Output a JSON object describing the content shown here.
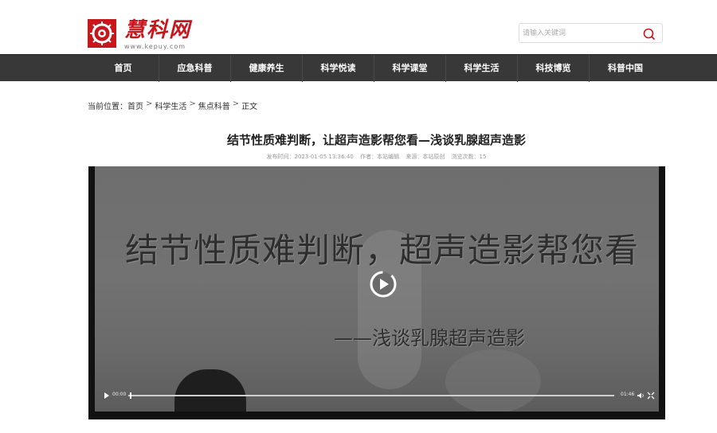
{
  "site": {
    "logo_text": "慧科网",
    "logo_url": "www.kepuy.com"
  },
  "search": {
    "placeholder": "请输入关键词"
  },
  "nav": {
    "items": [
      {
        "label": "首页"
      },
      {
        "label": "应急科普"
      },
      {
        "label": "健康养生"
      },
      {
        "label": "科学悦读"
      },
      {
        "label": "科学课堂"
      },
      {
        "label": "科学生活"
      },
      {
        "label": "科技博览"
      },
      {
        "label": "科普中国"
      }
    ]
  },
  "breadcrumb": {
    "prefix": "当前位置：",
    "items": [
      "首页",
      "科学生活",
      "焦点科普",
      "正文"
    ],
    "separator": ">"
  },
  "article": {
    "title": "结节性质难判断，让超声造影帮您看—浅谈乳腺超声造影",
    "meta": {
      "published": "发布时间：2023-01-05 13:36:40",
      "author": "作者：本站编辑",
      "source": "来源：本站原创",
      "views": "浏览次数：15"
    }
  },
  "video": {
    "overlay_title": "结节性质难判断，超声造影帮您看",
    "overlay_subtitle": "——浅谈乳腺超声造影",
    "current_time": "00:00",
    "duration": "01:46",
    "progress": 0.0
  }
}
